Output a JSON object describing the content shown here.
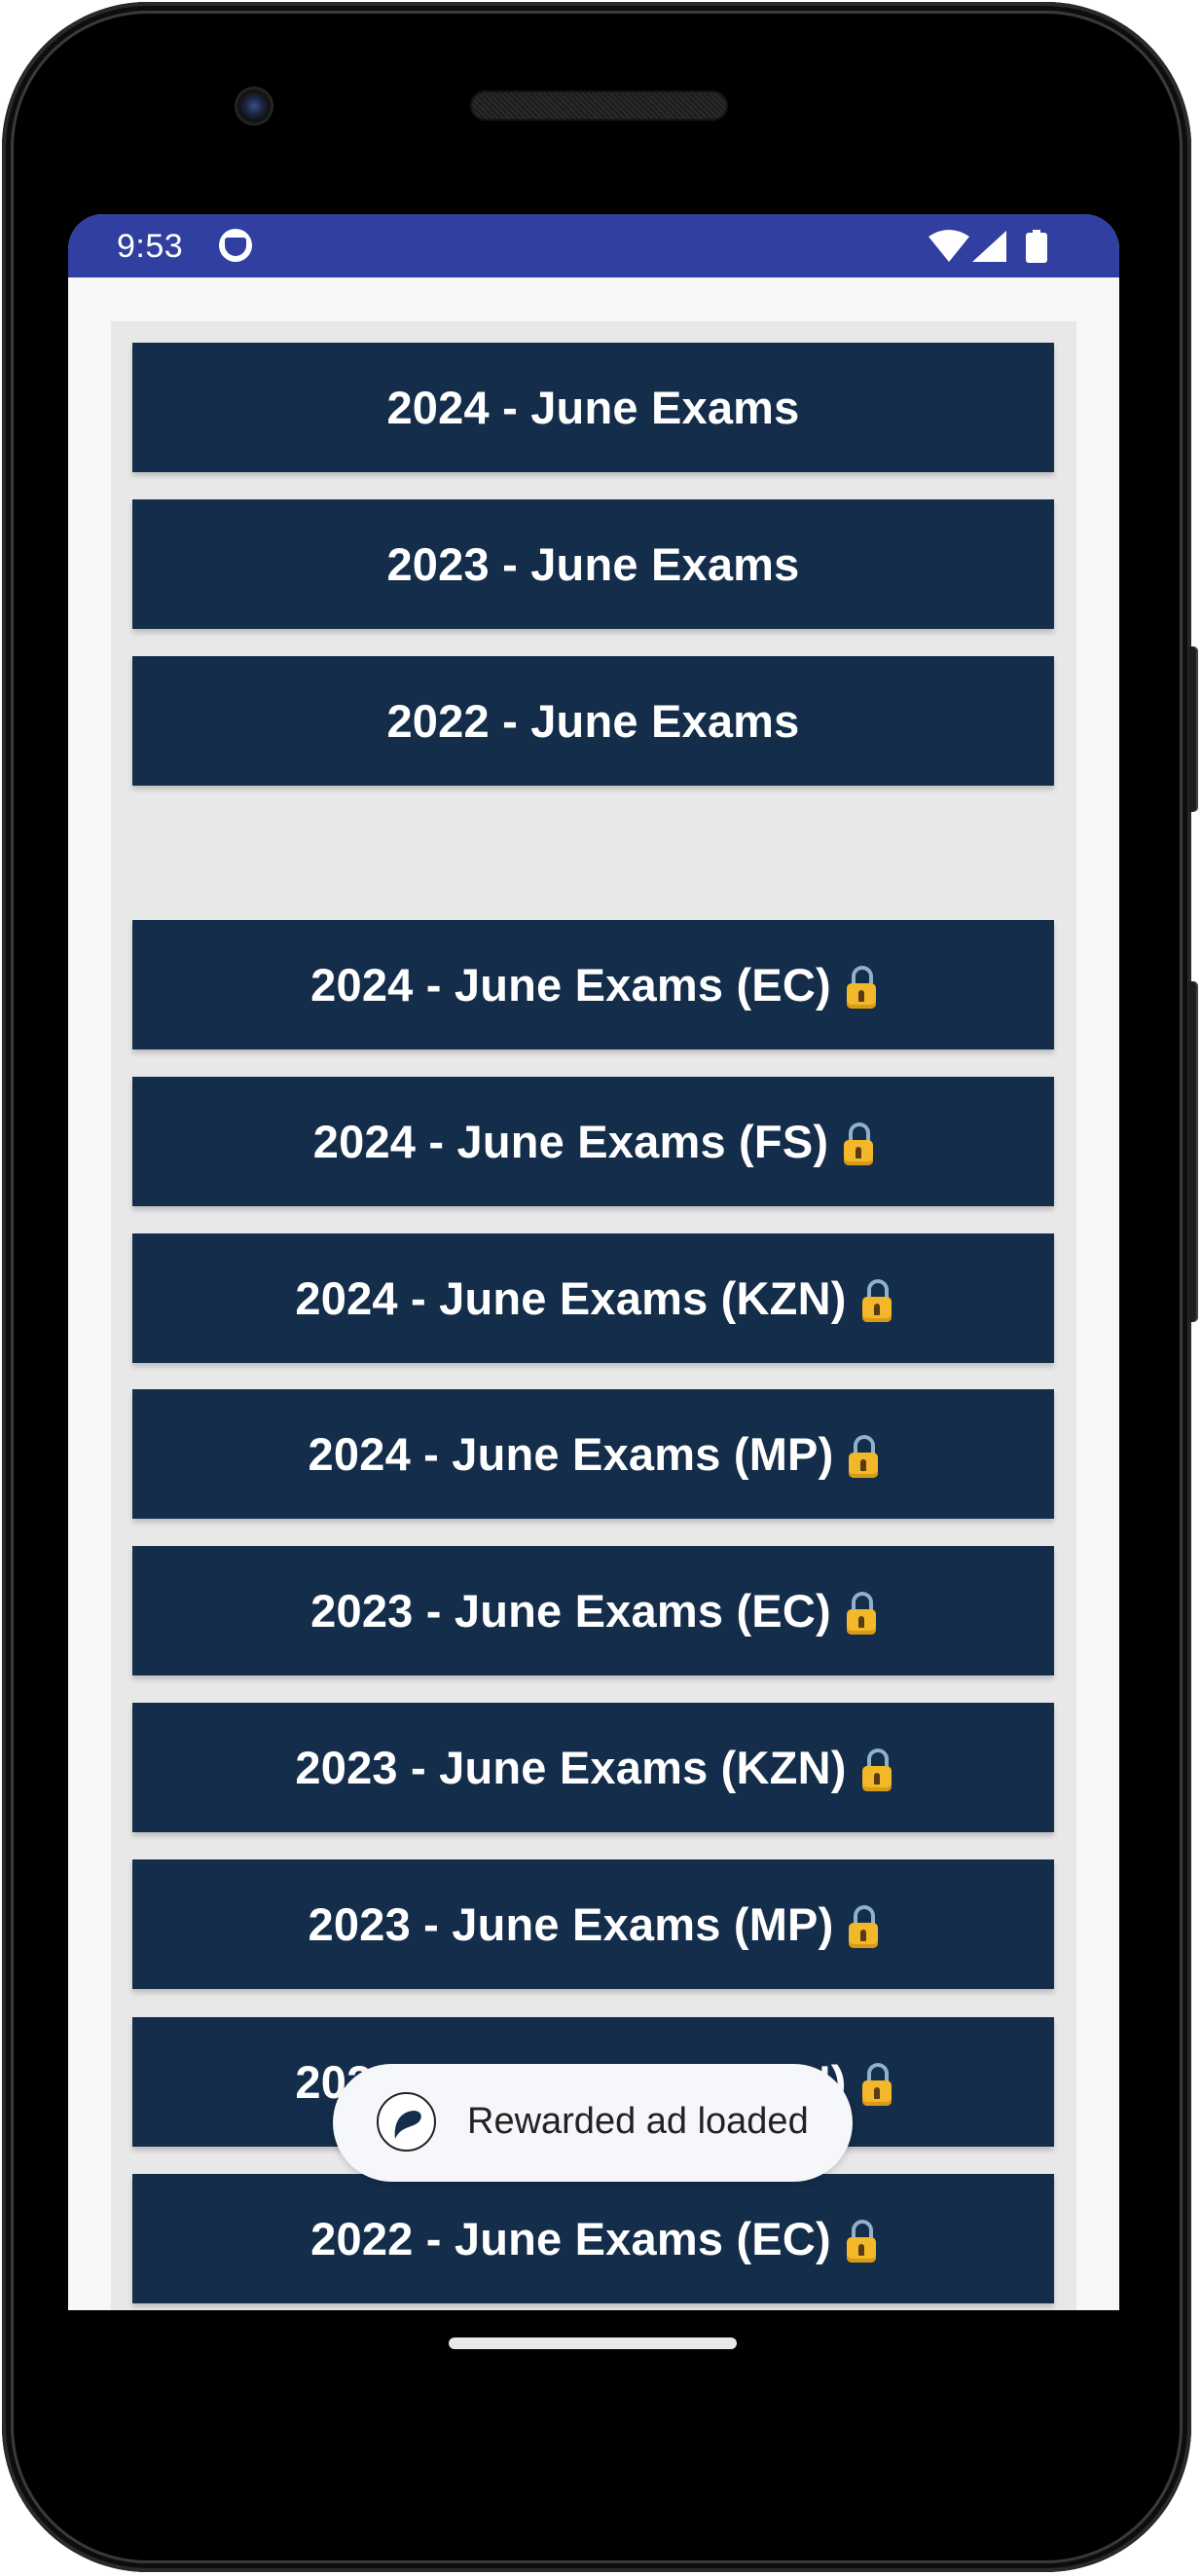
{
  "status_bar": {
    "time": "9:53",
    "icons": [
      "app-notification-icon",
      "wifi-icon",
      "cellular-signal-icon",
      "battery-icon"
    ],
    "color": "#3140a0"
  },
  "colors": {
    "button_bg": "#132d4a",
    "button_text": "#ffffff",
    "card_bg": "#e9e8e9",
    "screen_bg": "#f7f7f8"
  },
  "free_exams": [
    {
      "label": "2024 - June Exams",
      "locked": false
    },
    {
      "label": "2023 - June Exams",
      "locked": false
    },
    {
      "label": "2022 - June Exams",
      "locked": false
    }
  ],
  "locked_exams": [
    {
      "label": "2024 - June Exams (EC)",
      "locked": true,
      "icon": "lock-icon"
    },
    {
      "label": "2024 - June Exams (FS)",
      "locked": true,
      "icon": "lock-icon"
    },
    {
      "label": "2024 - June Exams (KZN)",
      "locked": true,
      "icon": "lock-icon"
    },
    {
      "label": "2024 - June Exams (MP)",
      "locked": true,
      "icon": "lock-icon"
    },
    {
      "label": "2023 - June Exams (EC)",
      "locked": true,
      "icon": "lock-icon"
    },
    {
      "label": "2023 - June Exams (KZN)",
      "locked": true,
      "icon": "lock-icon"
    },
    {
      "label": "2023 - June Exams (MP)",
      "locked": true,
      "icon": "lock-icon"
    },
    {
      "label": "2022 - June Exams (KZN)",
      "locked": true,
      "icon": "lock-icon"
    },
    {
      "label": "2022 - June Exams (EC)",
      "locked": true,
      "icon": "lock-icon"
    }
  ],
  "toast": {
    "message": "Rewarded ad loaded",
    "icon": "app-logo-icon"
  }
}
